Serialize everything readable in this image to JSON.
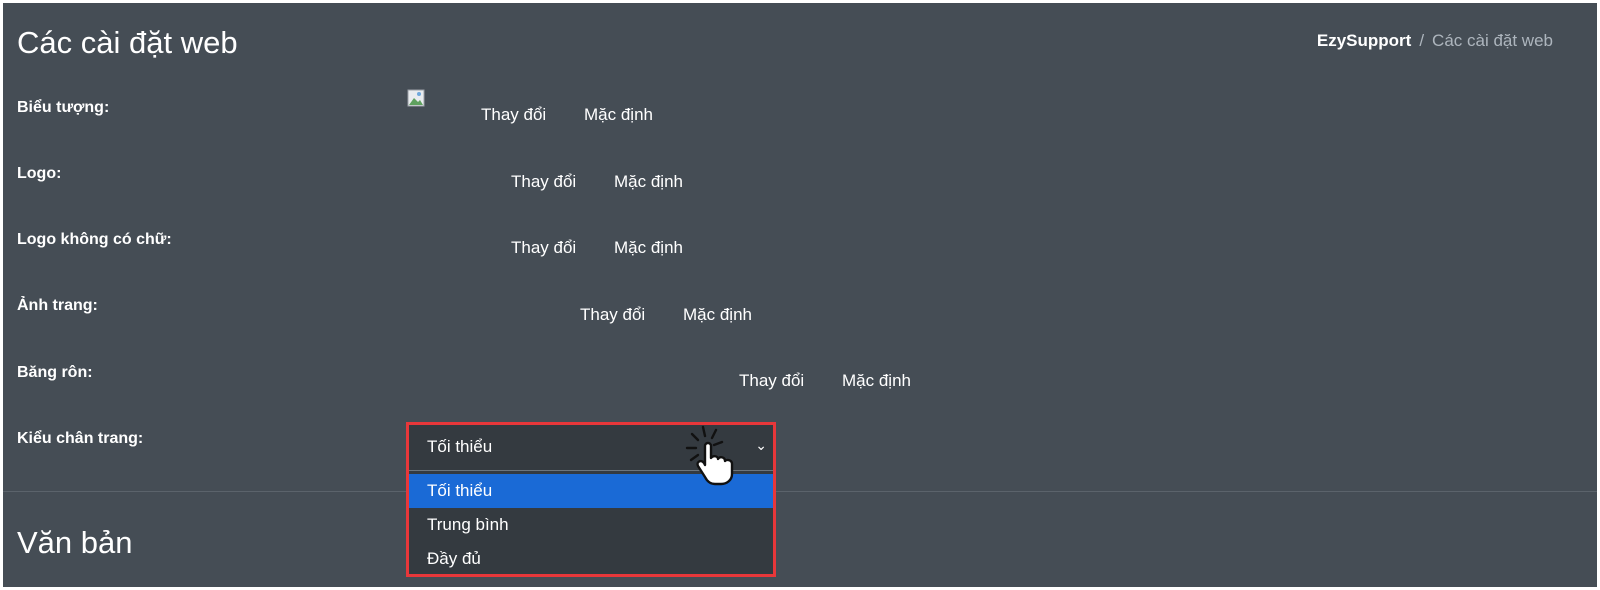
{
  "page": {
    "title": "Các cài đặt web",
    "breadcrumb": {
      "home": "EzySupport",
      "separator": "/",
      "current": "Các cài đặt web"
    }
  },
  "settings": [
    {
      "label": "Biểu tượng:",
      "change": "Thay đổi",
      "default": "Mặc định"
    },
    {
      "label": "Logo:",
      "change": "Thay đổi",
      "default": "Mặc định"
    },
    {
      "label": "Logo không có chữ:",
      "change": "Thay đổi",
      "default": "Mặc định"
    },
    {
      "label": "Ảnh trang:",
      "change": "Thay đổi",
      "default": "Mặc định"
    },
    {
      "label": "Băng rôn:",
      "change": "Thay đổi",
      "default": "Mặc định"
    }
  ],
  "footer_style": {
    "label": "Kiểu chân trang:",
    "selected": "Tối thiểu",
    "options": [
      "Tối thiểu",
      "Trung bình",
      "Đầy đủ"
    ],
    "highlight_color": "#e8373a",
    "selected_option_color": "#1a6ad6"
  },
  "section": {
    "title": "Văn bản"
  },
  "icons": {
    "chevron": "chevron-down-icon",
    "cursor": "hand-pointer-icon",
    "broken_image": "broken-image-icon"
  }
}
